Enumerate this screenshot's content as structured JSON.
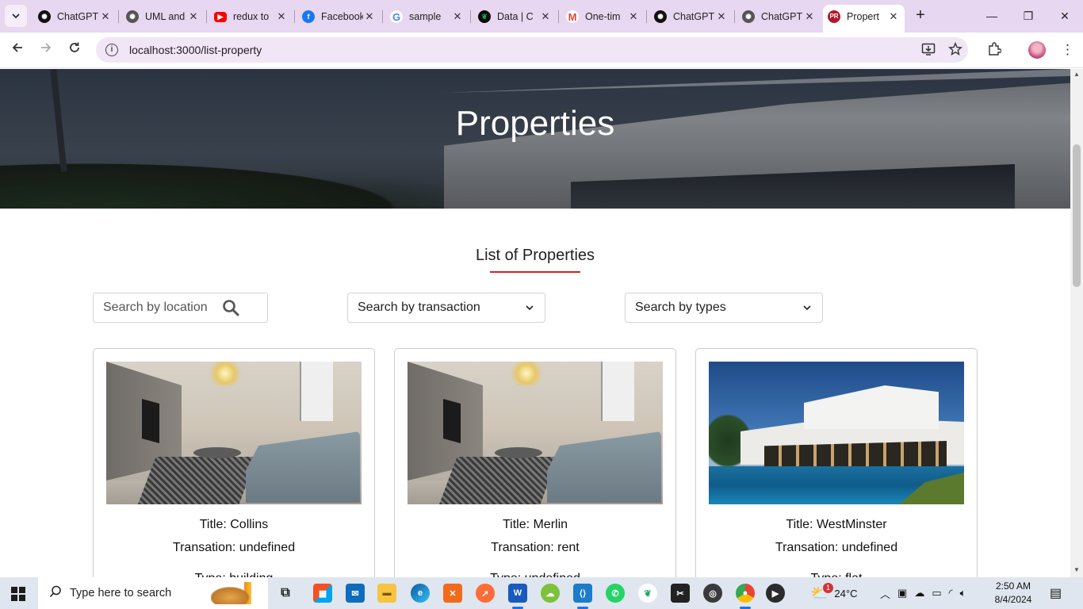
{
  "browser": {
    "tabs": [
      {
        "label": "ChatGPT",
        "icon": "chatgpt-icon",
        "color": "#111111"
      },
      {
        "label": "UML and",
        "icon": "chatgpt-icon",
        "color": "#555555"
      },
      {
        "label": "redux to",
        "icon": "youtube-icon",
        "color": "#ff0000"
      },
      {
        "label": "Facebook",
        "icon": "facebook-icon",
        "color": "#1877f2"
      },
      {
        "label": "sample",
        "icon": "google-icon",
        "color": "#4285f4"
      },
      {
        "label": "Data | C",
        "icon": "mongodb-icon",
        "color": "#13aa52"
      },
      {
        "label": "One-tim",
        "icon": "gmail-icon",
        "color": "#ea4335"
      },
      {
        "label": "ChatGPT",
        "icon": "chatgpt-icon",
        "color": "#111111"
      },
      {
        "label": "ChatGPT",
        "icon": "chatgpt-icon",
        "color": "#555555"
      },
      {
        "label": "Propert",
        "icon": "pr-site-icon",
        "color": "#b5172b",
        "active": true
      }
    ],
    "url": "localhost:3000/list-property"
  },
  "hero": {
    "title": "Properties"
  },
  "section": {
    "title": "List of Properties",
    "accent": "#d82020"
  },
  "filters": {
    "location_placeholder": "Search by location",
    "transaction_selected": "Search by transaction",
    "types_selected": "Search by types"
  },
  "properties": [
    {
      "title": "Title: Collins",
      "transaction": "Transation: undefined",
      "type": "Type: building",
      "image": "living-room-photo"
    },
    {
      "title": "Title: Merlin",
      "transaction": "Transation: rent",
      "type": "Type: undefined",
      "image": "living-room-photo"
    },
    {
      "title": "Title: WestMinster",
      "transaction": "Transation: undefined",
      "type": "Type: flat",
      "image": "villa-pool-photo"
    }
  ],
  "taskbar": {
    "search_placeholder": "Type here to search",
    "weather": "24°C",
    "time": "2:50 AM",
    "date": "8/4/2024",
    "notification_count": "1"
  }
}
